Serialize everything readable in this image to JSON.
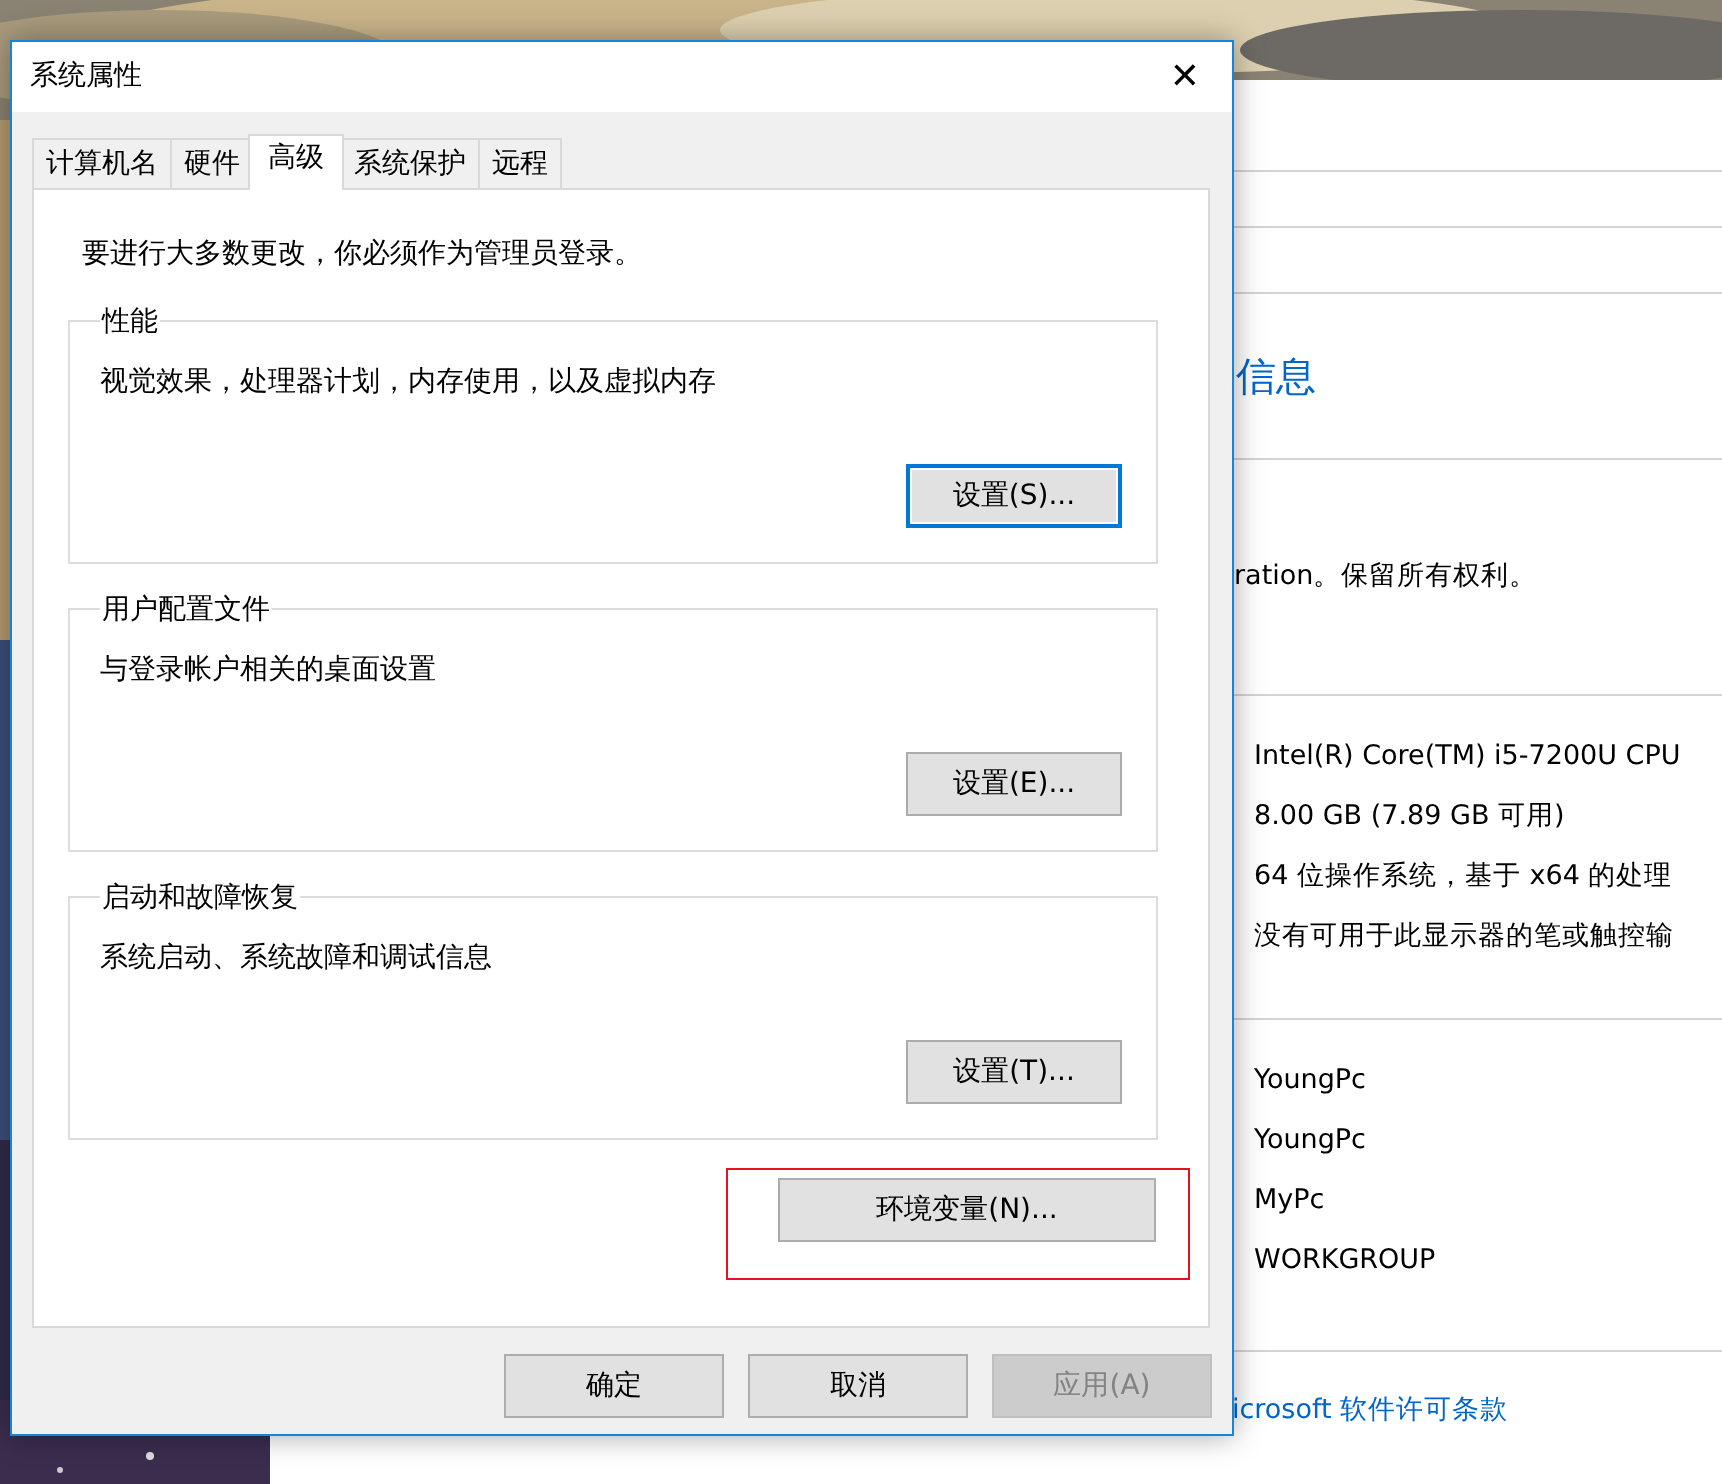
{
  "background_window": {
    "heading": "信息",
    "copyright": "ration。保留所有权利。",
    "specs": [
      "Intel(R) Core(TM) i5-7200U CPU",
      "8.00 GB (7.89 GB 可用)",
      "64 位操作系统，基于 x64 的处理",
      "没有可用于此显示器的笔或触控输"
    ],
    "names": [
      "YoungPc",
      "YoungPc",
      "MyPc",
      "WORKGROUP"
    ],
    "license_link": "icrosoft 软件许可条款"
  },
  "dialog": {
    "title": "系统属性",
    "close": "✕",
    "tabs": [
      {
        "label": "计算机名",
        "selected": false
      },
      {
        "label": "硬件",
        "selected": false
      },
      {
        "label": "高级",
        "selected": true
      },
      {
        "label": "系统保护",
        "selected": false
      },
      {
        "label": "远程",
        "selected": false
      }
    ],
    "admin_note": "要进行大多数更改，你必须作为管理员登录。",
    "groups": [
      {
        "title": "性能",
        "description": "视觉效果，处理器计划，内存使用，以及虚拟内存",
        "button": "设置(S)...",
        "focused": true
      },
      {
        "title": "用户配置文件",
        "description": "与登录帐户相关的桌面设置",
        "button": "设置(E)...",
        "focused": false
      },
      {
        "title": "启动和故障恢复",
        "description": "系统启动、系统故障和调试信息",
        "button": "设置(T)...",
        "focused": false
      }
    ],
    "env_button": {
      "label": "环境变量(N)...",
      "highlighted": true
    },
    "buttons": [
      {
        "label": "确定",
        "disabled": false
      },
      {
        "label": "取消",
        "disabled": false
      },
      {
        "label": "应用(A)",
        "disabled": true
      }
    ]
  }
}
